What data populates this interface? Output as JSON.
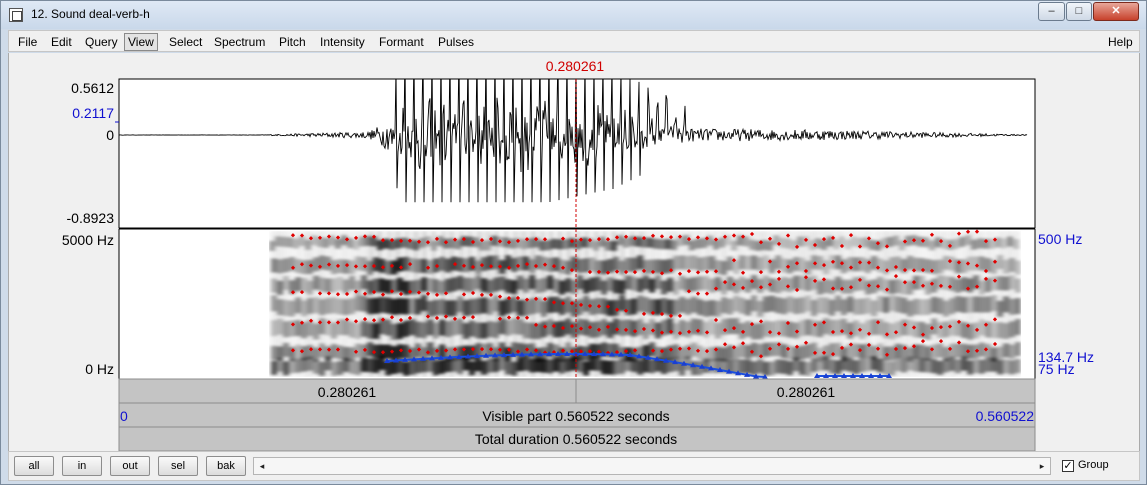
{
  "window": {
    "title": "12. Sound deal-verb-h",
    "minimize": "–",
    "maximize": "□",
    "close": "✕"
  },
  "menu": [
    "File",
    "Edit",
    "Query",
    "View",
    "Select",
    "Spectrum",
    "Pitch",
    "Intensity",
    "Formant",
    "Pulses"
  ],
  "menu_active": "View",
  "menu_help": "Help",
  "cursor": {
    "time_label": "0.280261",
    "time": 0.280261
  },
  "waveform": {
    "max_label": "0.5612",
    "cursor_amp_label": "0.2117",
    "zero_label": "0",
    "min_label": "-0.8923"
  },
  "spectrogram": {
    "top_label": "5000 Hz",
    "bottom_label": "0 Hz",
    "pitch_top_label": "500 Hz",
    "pitch_value_label": "134.7 Hz",
    "pitch_bottom_label": "75 Hz"
  },
  "time_bars": {
    "left_segment": "0.280261",
    "right_segment": "0.280261",
    "visible_start": "0",
    "visible_text": "Visible part 0.560522 seconds",
    "visible_end": "0.560522",
    "total_text": "Total duration 0.560522 seconds"
  },
  "buttons": [
    "all",
    "in",
    "out",
    "sel",
    "bak"
  ],
  "scroll": {
    "left_arrow": "◂",
    "right_arrow": "▸"
  },
  "group": {
    "label": "Group",
    "checked": "✓"
  },
  "colors": {
    "cursor": "#d00000",
    "axis_blue": "#1010d0",
    "formant": "#e00000",
    "pitch": "#1a4fe0",
    "bar_bg": "#c4c4c4"
  }
}
